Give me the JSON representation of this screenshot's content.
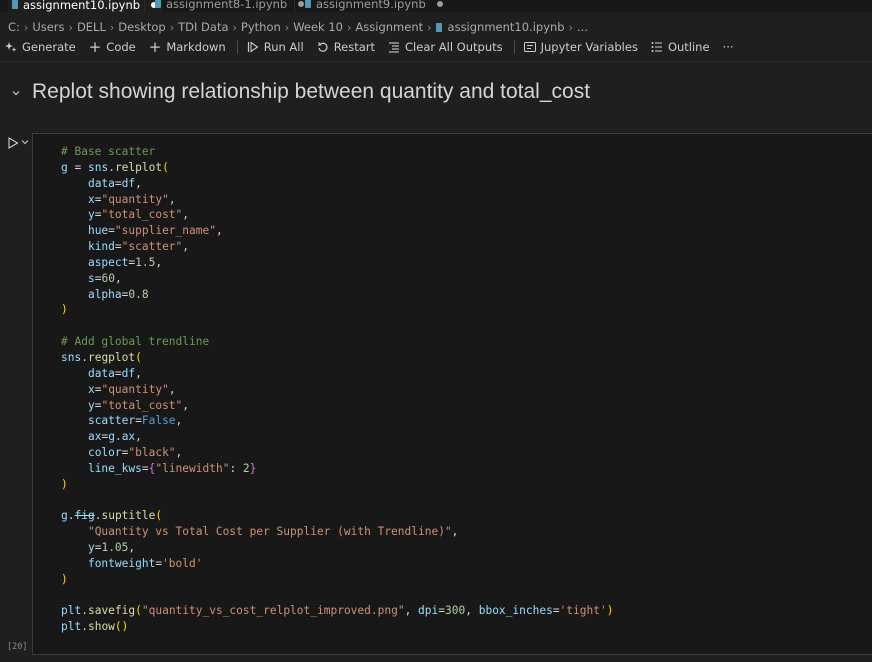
{
  "tabs": [
    {
      "label": "assignment10.ipynb",
      "active": true
    },
    {
      "label": "assignment8-1.ipynb",
      "active": false
    },
    {
      "label": "assignment9.ipynb",
      "active": false
    }
  ],
  "breadcrumb": [
    "C:",
    "Users",
    "DELL",
    "Desktop",
    "TDI Data",
    "Python",
    "Week 10",
    "Assignment",
    "assignment10.ipynb",
    "..."
  ],
  "toolbar": {
    "generate": "Generate",
    "code": "Code",
    "markdown": "Markdown",
    "run_all": "Run All",
    "restart": "Restart",
    "clear_all_outputs": "Clear All Outputs",
    "jupyter_variables": "Jupyter Variables",
    "outline": "Outline",
    "more": "···"
  },
  "markdown_cell": {
    "title": "Replot showing relationship between quantity and total_cost"
  },
  "code_cell": {
    "execution_count": "[20]",
    "source": [
      "# Base scatter",
      "g = sns.relplot(",
      "    data=df,",
      "    x=\"quantity\",",
      "    y=\"total_cost\",",
      "    hue=\"supplier_name\",",
      "    kind=\"scatter\",",
      "    aspect=1.5,",
      "    s=60,",
      "    alpha=0.8",
      ")",
      "",
      "# Add global trendline",
      "sns.regplot(",
      "    data=df,",
      "    x=\"quantity\",",
      "    y=\"total_cost\",",
      "    scatter=False,",
      "    ax=g.ax,",
      "    color=\"black\",",
      "    line_kws={\"linewidth\": 2}",
      ")",
      "",
      "g.fig.suptitle(",
      "    \"Quantity vs Total Cost per Supplier (with Trendline)\",",
      "    y=1.05,",
      "    fontweight='bold'",
      ")",
      "",
      "plt.savefig(\"quantity_vs_cost_relplot_improved.png\", dpi=300, bbox_inches='tight')",
      "plt.show()"
    ]
  },
  "colors": {
    "background": "#1f1f1f",
    "cell_background": "#181818",
    "accent": "#0078d4",
    "comment": "#6a9955",
    "string": "#ce9178",
    "number": "#b5cea8",
    "variable": "#9cdcfe",
    "function": "#dcdcaa",
    "keyword": "#569cd6"
  }
}
